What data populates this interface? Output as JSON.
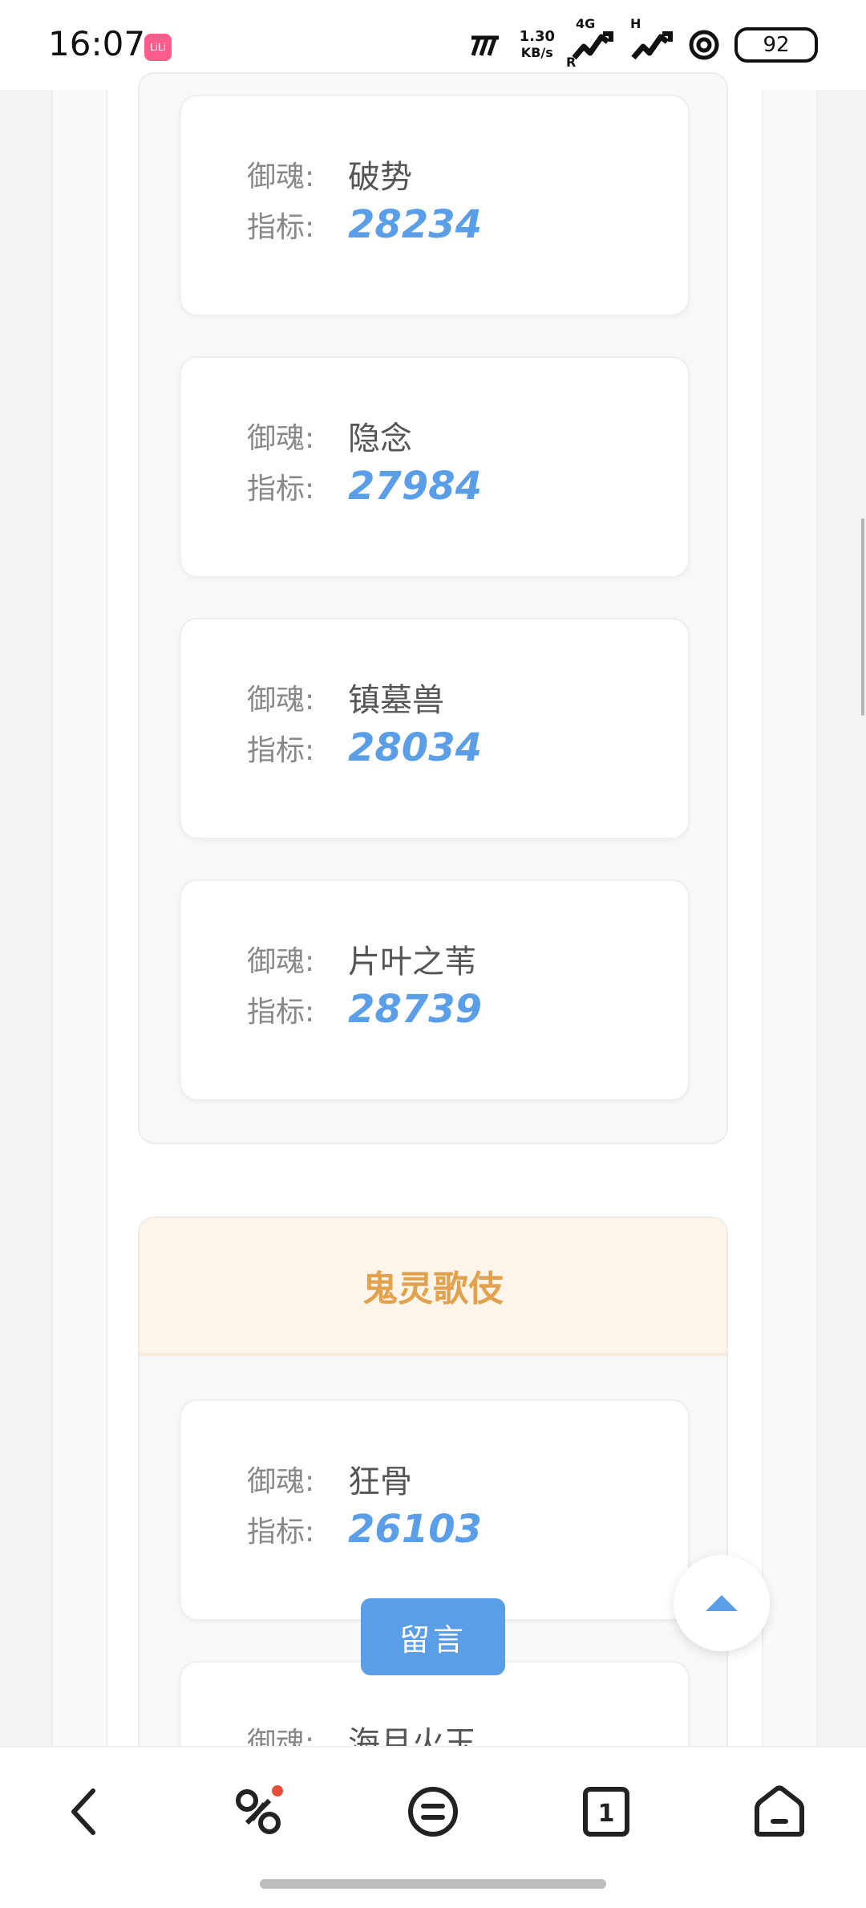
{
  "status_bar": {
    "time": "16:07",
    "app_badge": "LiLi",
    "net_speed_value": "1.30",
    "net_speed_unit": "KB/s",
    "network_1": "4G",
    "network_1_sub": "R",
    "network_2": "H",
    "battery": "92"
  },
  "labels": {
    "soul": "御魂:",
    "metric": "指标:"
  },
  "group1": {
    "cards": [
      {
        "soul": "破势",
        "metric": "28234"
      },
      {
        "soul": "隐念",
        "metric": "27984"
      },
      {
        "soul": "镇墓兽",
        "metric": "28034"
      },
      {
        "soul": "片叶之苇",
        "metric": "28739"
      }
    ]
  },
  "group2": {
    "title": "鬼灵歌伎",
    "cards": [
      {
        "soul": "狂骨",
        "metric": "26103"
      },
      {
        "soul": "海月火玉"
      }
    ]
  },
  "buttons": {
    "message": "留言"
  },
  "colors": {
    "accent": "#5b9ee8",
    "group_title": "#e2a24d",
    "group_header_bg": "#fdf4ea"
  },
  "icons": {
    "back": "chevron-left-icon",
    "link": "link-icon",
    "menu": "menu-icon",
    "tabs": "tabs-icon",
    "home": "home-icon",
    "scroll_top": "arrow-up-icon"
  },
  "nav": {
    "tabs_count": "1"
  }
}
